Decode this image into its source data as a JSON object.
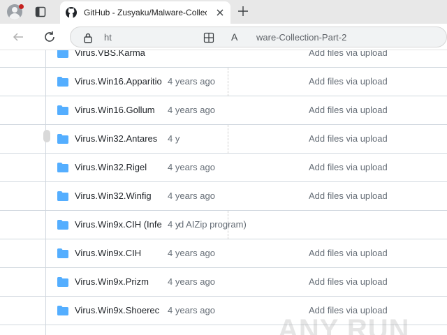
{
  "browser": {
    "tab_title": "GitHub - Zusyaku/Malware-Collec",
    "url_start": "ht",
    "url_end": "ware-Collection-Part-2"
  },
  "files": [
    {
      "name": "Virus.VBS.Karma",
      "age": "",
      "message": "Add files via upload"
    },
    {
      "name": "Virus.Win16.Apparitio",
      "age": "4 years ago",
      "message": "Add files via upload"
    },
    {
      "name": "Virus.Win16.Gollum",
      "age": "4 years ago",
      "message": "Add files via upload"
    },
    {
      "name": "Virus.Win32.Antares",
      "age": "4 y",
      "message": "Add files via upload"
    },
    {
      "name": "Virus.Win32.Rigel",
      "age": "4 years ago",
      "message": "Add files via upload"
    },
    {
      "name": "Virus.Win32.Winfig",
      "age": "4 years ago",
      "message": "Add files via upload"
    },
    {
      "name": "Virus.Win9x.CIH (Infe",
      "age": "4 y",
      "extra": "d AIZip program)",
      "message": ""
    },
    {
      "name": "Virus.Win9x.CIH",
      "age": "4 years ago",
      "message": "Add files via upload"
    },
    {
      "name": "Virus.Win9x.Prizm",
      "age": "4 years ago",
      "message": "Add files via upload"
    },
    {
      "name": "Virus.Win9x.Shoerec",
      "age": "4 years ago",
      "message": "Add files via upload"
    }
  ],
  "watermark": "ANY RUN",
  "colors": {
    "folder": "#54aeff",
    "muted": "#656d76",
    "border": "#d0d7de"
  }
}
